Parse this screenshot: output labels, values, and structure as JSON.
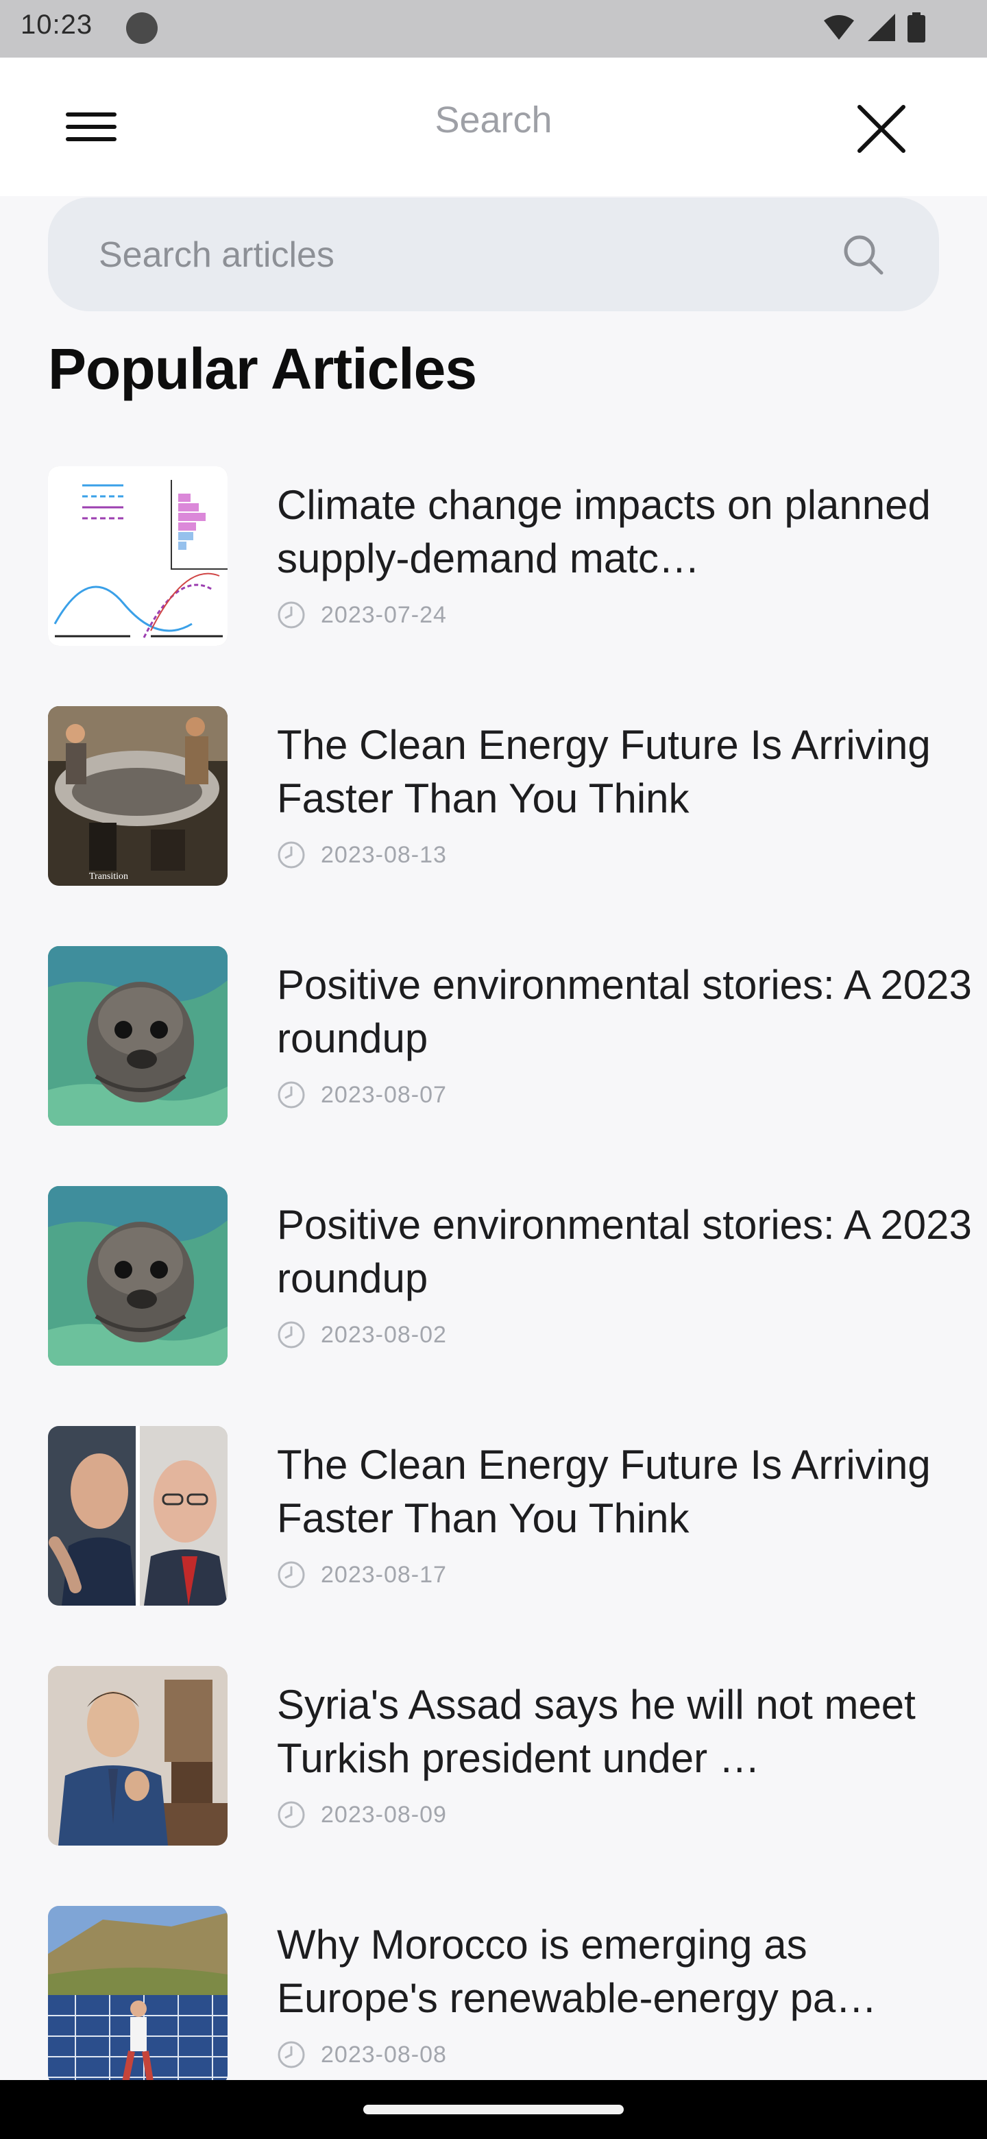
{
  "status_bar": {
    "time": "10:23"
  },
  "app_bar": {
    "title": "Search"
  },
  "search": {
    "placeholder": "Search articles",
    "value": ""
  },
  "section": {
    "title": "Popular Articles"
  },
  "articles": [
    {
      "title": "Climate change impacts on planned supply-demand matc…",
      "date": "2023-07-24",
      "thumbnail": "supply-demand-chart"
    },
    {
      "title": "The Clean Energy Future Is Arriving Faster Than You Think",
      "date": "2023-08-13",
      "thumbnail": "workers-photo"
    },
    {
      "title": "Positive environmental stories: A 2023 roundup",
      "date": "2023-08-07",
      "thumbnail": "seal-photo"
    },
    {
      "title": "Positive environmental stories: A 2023 roundup",
      "date": "2023-08-02",
      "thumbnail": "seal-photo"
    },
    {
      "title": "The Clean Energy Future Is Arriving Faster Than You Think",
      "date": "2023-08-17",
      "thumbnail": "politicians-photo"
    },
    {
      "title": "Syria's Assad says he will not meet Turkish president under …",
      "date": "2023-08-09",
      "thumbnail": "assad-photo"
    },
    {
      "title": "Why Morocco is emerging as Europe's renewable-energy pa…",
      "date": "2023-08-08",
      "thumbnail": "solar-farm-photo"
    }
  ],
  "icons": {
    "menu": "menu-icon",
    "close": "close-icon",
    "search": "search-icon",
    "clock": "clock-icon"
  },
  "colors": {
    "background": "#f7f7f9",
    "app_bar": "#ffffff",
    "search_field": "#e8ebf0",
    "muted_text": "#a3a6ad",
    "title_text": "#1d1d1f"
  }
}
